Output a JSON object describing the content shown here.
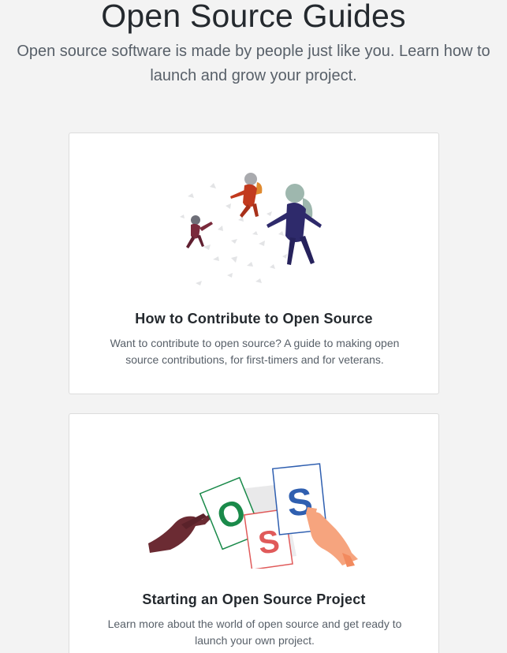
{
  "header": {
    "title": "Open Source Guides",
    "subtitle": "Open source software is made by people just like you. Learn how to launch and grow your project."
  },
  "cards": [
    {
      "title": "How to Contribute to Open Source",
      "description": "Want to contribute to open source? A guide to making open source contributions, for first-timers and for veterans.",
      "illustration": "astronauts-floating-illustration"
    },
    {
      "title": "Starting an Open Source Project",
      "description": "Learn more about the world of open source and get ready to launch your own project.",
      "illustration": "hands-with-letter-cards-illustration",
      "letters": [
        "O",
        "S",
        "S"
      ]
    }
  ],
  "colors": {
    "background": "#f3f3f3",
    "card": "#ffffff",
    "title_text": "#24292e",
    "body_text": "#586069",
    "letter_o": "#1a8a4a",
    "letter_s_red": "#e05a5a",
    "letter_s_blue": "#2f5fb0"
  }
}
